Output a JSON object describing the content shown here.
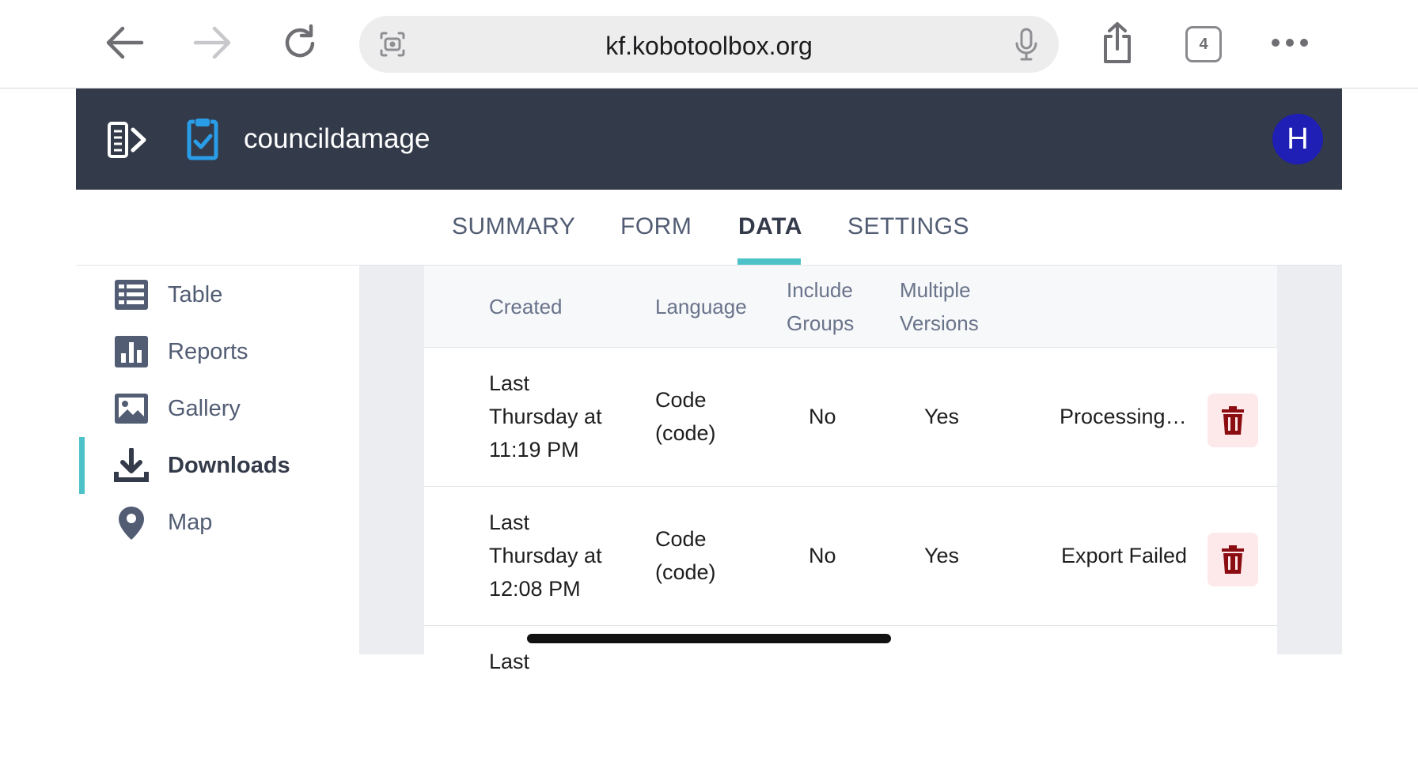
{
  "browser": {
    "url": "kf.kobotoolbox.org",
    "tab_count": "4"
  },
  "app": {
    "title": "councildamage",
    "avatar_initial": "H",
    "brand_color": "#333a49",
    "accent_color": "#4ec2c9"
  },
  "tabs": [
    {
      "label": "SUMMARY"
    },
    {
      "label": "FORM"
    },
    {
      "label": "DATA"
    },
    {
      "label": "SETTINGS"
    }
  ],
  "active_tab": "DATA",
  "sidebar": {
    "items": [
      {
        "label": "Table",
        "icon": "table-icon"
      },
      {
        "label": "Reports",
        "icon": "bar-chart-icon"
      },
      {
        "label": "Gallery",
        "icon": "image-icon"
      },
      {
        "label": "Downloads",
        "icon": "download-icon"
      },
      {
        "label": "Map",
        "icon": "map-pin-icon"
      }
    ],
    "active": "Downloads"
  },
  "exports_table": {
    "headers": {
      "created": "Created",
      "language": "Language",
      "include_groups_1": "Include",
      "include_groups_2": "Groups",
      "multiple_versions_1": "Multiple",
      "multiple_versions_2": "Versions"
    },
    "rows": [
      {
        "created_1": "Last",
        "created_2": "Thursday at",
        "created_3": "11:19 PM",
        "language_1": "Code",
        "language_2": "(code)",
        "include_groups": "No",
        "multiple_versions": "Yes",
        "status": "Processing…"
      },
      {
        "created_1": "Last",
        "created_2": "Thursday at",
        "created_3": "12:08 PM",
        "language_1": "Code",
        "language_2": "(code)",
        "include_groups": "No",
        "multiple_versions": "Yes",
        "status": "Export Failed"
      }
    ],
    "partial_row_created": "Last"
  }
}
